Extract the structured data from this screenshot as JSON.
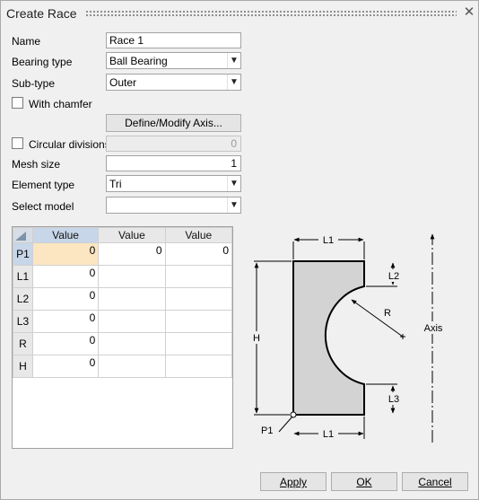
{
  "window": {
    "title": "Create Race"
  },
  "form": {
    "name_label": "Name",
    "name_value": "Race 1",
    "bearing_type_label": "Bearing type",
    "bearing_type_value": "Ball Bearing",
    "subtype_label": "Sub-type",
    "subtype_value": "Outer",
    "chamfer_label": "With chamfer",
    "chamfer_checked": false,
    "define_axis_button": "Define/Modify Axis...",
    "circular_label": "Circular divisions",
    "circular_checked": false,
    "circular_value": "0",
    "mesh_size_label": "Mesh size",
    "mesh_size_value": "1",
    "element_type_label": "Element type",
    "element_type_value": "Tri",
    "select_model_label": "Select model",
    "select_model_value": ""
  },
  "grid": {
    "columns": [
      "Value",
      "Value",
      "Value"
    ],
    "rows": [
      {
        "label": "P1",
        "values": [
          "0",
          "0",
          "0"
        ]
      },
      {
        "label": "L1",
        "values": [
          "0",
          "",
          ""
        ]
      },
      {
        "label": "L2",
        "values": [
          "0",
          "",
          ""
        ]
      },
      {
        "label": "L3",
        "values": [
          "0",
          "",
          ""
        ]
      },
      {
        "label": "R",
        "values": [
          "0",
          "",
          ""
        ]
      },
      {
        "label": "H",
        "values": [
          "0",
          "",
          ""
        ]
      }
    ]
  },
  "diagram": {
    "labels": {
      "l1_top": "L1",
      "l1_bottom": "L1",
      "l2": "L2",
      "l3": "L3",
      "r": "R",
      "h": "H",
      "p1": "P1",
      "axis": "Axis"
    }
  },
  "buttons": {
    "apply": "Apply",
    "ok": "OK",
    "cancel": "Cancel"
  },
  "icons": {
    "close": "close-icon",
    "dropdown": "chevron-down-icon"
  }
}
